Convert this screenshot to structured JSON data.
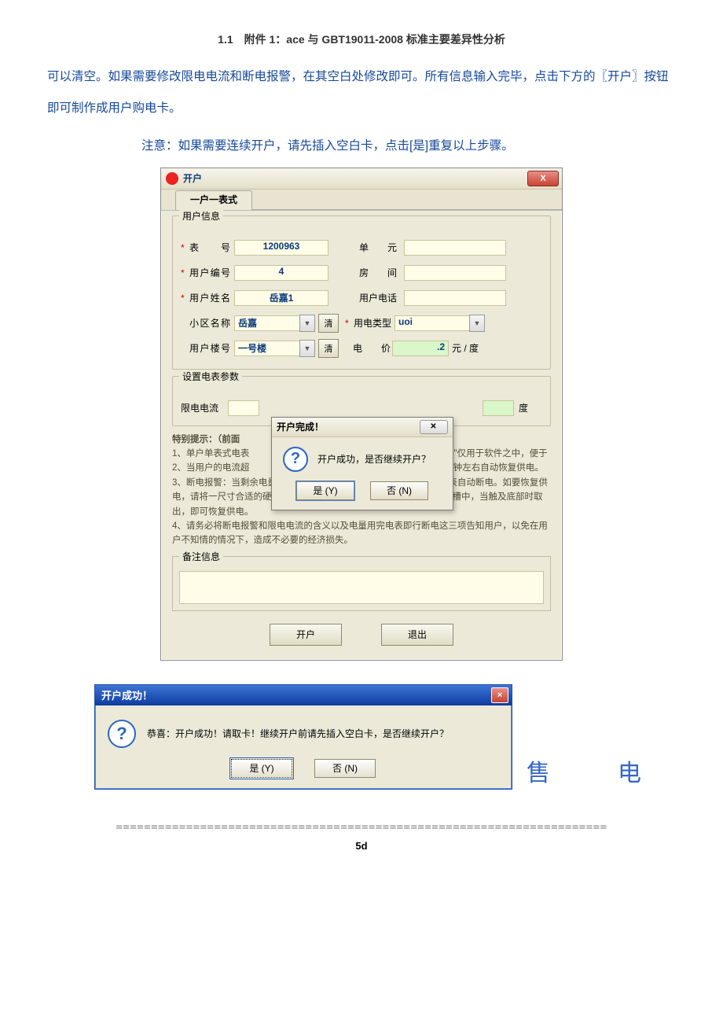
{
  "doc": {
    "header": "1.1　附件 1：ace 与 GBT19011-2008 标准主要差异性分析",
    "para1": "可以清空。如果需要修改限电电流和断电报警，在其空白处修改即可。所有信息输入完毕，点击下方的〖开户〗按钮即可制作成用户购电卡。",
    "note": "注意：如果需要连续开户，请先插入空白卡，点击[是]重复以上步骤。",
    "divider": "======================================================================",
    "pagenum": "5d"
  },
  "win1": {
    "title": "开户",
    "close_x": "X",
    "tab": "一户一表式",
    "group_user": "用户信息",
    "labels": {
      "meter_no": "表　　号",
      "unit": "单　　元",
      "user_no": "用户编号",
      "room": "房　　间",
      "user_name": "用户姓名",
      "phone": "用户电话",
      "area": "小区名称",
      "elec_type": "用电类型",
      "building": "用户楼号",
      "price": "电　　价",
      "price_unit": "元 / 度",
      "clear": "清"
    },
    "values": {
      "meter_no": "1200963",
      "user_no": "4",
      "user_name": "岳嘉1",
      "area": "岳嘉",
      "elec_type": "uoi",
      "building": "一号楼",
      "price": ".2"
    },
    "group_param": "设置电表参数",
    "limit_label": "限电电流",
    "degree_unit": "度",
    "tips_head": "特别提示：（前面",
    "tips_line1a": "1、单户单表式电表",
    "tips_line1b": "\"用户编号\"仅用于软件之中，便于",
    "tips_line2": "2、当用户的电流超　　　　　　　　　　　　　　　　　　　　，5分钟左右自动恢复供电。",
    "tips_line3": "3、断电报警：当剩余电量降至断电报警值（软件设定不为零）时，电表自动断电。如要恢复供电，请将一尺寸合适的硬卡（比如身份证或纸牌）插到电表右侧的插卡槽中，当触及底部时取出，即可恢复供电。",
    "tips_line4": "4、请务必将断电报警和限电电流的含义以及电量用完电表即行断电这三项告知用户，以免在用户不知情的情况下，造成不必要的经济损失。",
    "remark_label": "备注信息",
    "btn_open": "开户",
    "btn_exit": "退出"
  },
  "modal": {
    "title": "开户完成！",
    "close": "✕",
    "msg": "开户成功，是否继续开户？",
    "yes": "是 (Y)",
    "no": "否 (N)"
  },
  "win2": {
    "title": "开户成功！",
    "msg": "恭喜：开户成功！请取卡！继续开户前请先插入空白卡，是否继续开户？",
    "yes": "是 (Y)",
    "no": "否 (N)",
    "close_x": "×"
  },
  "side": "售　电"
}
